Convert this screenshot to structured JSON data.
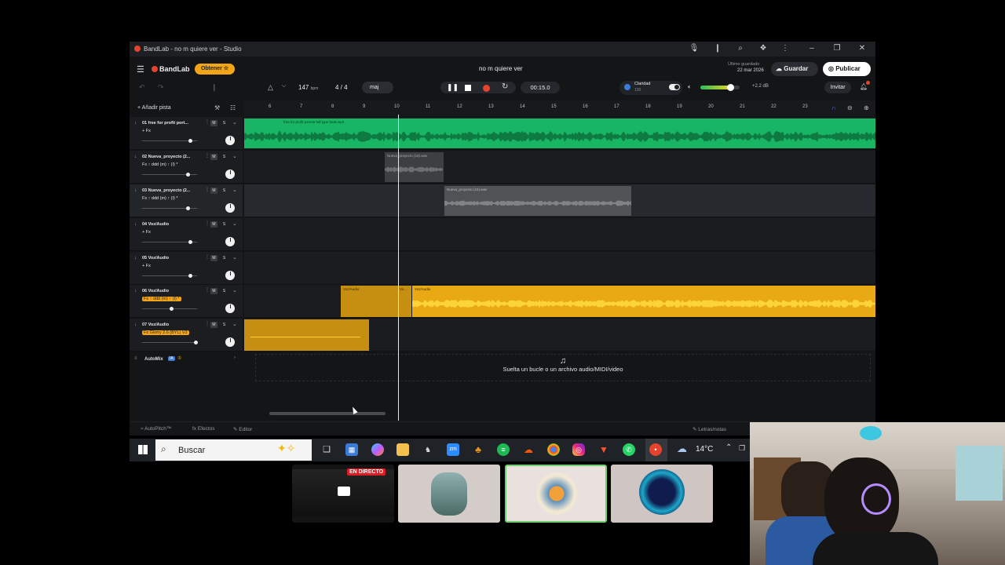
{
  "window": {
    "title": "BandLab - no m quiere ver - Studio",
    "controls": [
      "mic-icon",
      "sidebar-icon",
      "zoom-icon",
      "extensions-icon",
      "more-icon",
      "minimize-icon",
      "restore-icon",
      "close-icon"
    ]
  },
  "app": {
    "brand": "BandLab",
    "get_label": "Obtener",
    "project_name": "no m quiere ver",
    "saved_label": "Último guardado",
    "saved_date": "22 mar 2026",
    "save_label": "Guardar",
    "publish_label": "Publicar",
    "invite_label": "Invitar"
  },
  "toolbar": {
    "bpm": "147",
    "bpm_unit": "bpm",
    "time_signature": "4 / 4",
    "key": "maj",
    "time": "00:15.0",
    "clarity_label": "Claridad",
    "clarity_value": "100",
    "gain": "+2.2 dB",
    "volume_level": 0.75
  },
  "tracks_header": {
    "add_track": "Añadir pista"
  },
  "ruler": {
    "ticks": [
      "6",
      "7",
      "8",
      "9",
      "10",
      "11",
      "12",
      "13",
      "14",
      "15",
      "16",
      "17",
      "18",
      "19",
      "20",
      "21",
      "22",
      "23"
    ]
  },
  "tracks": [
    {
      "name": "01  free for profit port...",
      "fx": "+ Fx",
      "fx_highlight": false,
      "volume": 0.9
    },
    {
      "name": "02  Nueva_proyecto (2...",
      "fx": "Fx ↑ ddd (m) ↑ (I) *",
      "fx_highlight": false,
      "volume": 0.85
    },
    {
      "name": "03  Nueva_proyecto (2...",
      "fx": "Fx ↑ ddd (m) ↑ (I) *",
      "fx_highlight": false,
      "volume": 0.85
    },
    {
      "name": "04  Voz/Audio",
      "fx": "+ Fx",
      "fx_highlight": false,
      "volume": 0.9
    },
    {
      "name": "05  Voz/Audio",
      "fx": "+ Fx",
      "fx_highlight": false,
      "volume": 0.9
    },
    {
      "name": "06  Voz/Audio",
      "fx": "Fx ↑ ddd (m) ↑ (I) *",
      "fx_highlight": true,
      "volume": 0.55
    },
    {
      "name": "07  Voz/Audio",
      "fx": "Fx Glorry 2.6 (BYL) V2",
      "fx_highlight": true,
      "volume": 1.0
    }
  ],
  "clips": {
    "c1": "free for profit pxm46 hdl type beat.mp3",
    "c2": "Nueva_proyecto (16).wav",
    "c3": "Nueva_proyecto (16).wav",
    "c4": "Voz/Audio",
    "c5": "Vo...",
    "c6": "Voz/Audio"
  },
  "automix": {
    "label": "AutoMix",
    "badge": "IA"
  },
  "drop_zone": {
    "text": "Suelta un bucle o un archivo audio/MIDI/video"
  },
  "bottom_bar": {
    "autopitch": "AutoPitch™",
    "effects": "Efectos",
    "editor": "Editor",
    "lyrics": "Letras/notas"
  },
  "taskbar": {
    "search_placeholder": "Buscar",
    "weather": "14°C",
    "apps": [
      "start-icon",
      "taskview-icon",
      "store-icon",
      "copilot-icon",
      "files-icon",
      "game-icon",
      "zoom-icon",
      "fl-icon",
      "spotify-icon",
      "soundcloud-icon",
      "chrome-icon",
      "instagram-icon",
      "brave-icon",
      "whatsapp-icon",
      "bandlab-icon"
    ]
  },
  "thumbnails": {
    "live_badge": "EN DIRECTO"
  },
  "colors": {
    "green_track": "#17b564",
    "gold_track": "#e8a914",
    "accent_red": "#e6432f",
    "publish_bg": "#ffffff"
  }
}
